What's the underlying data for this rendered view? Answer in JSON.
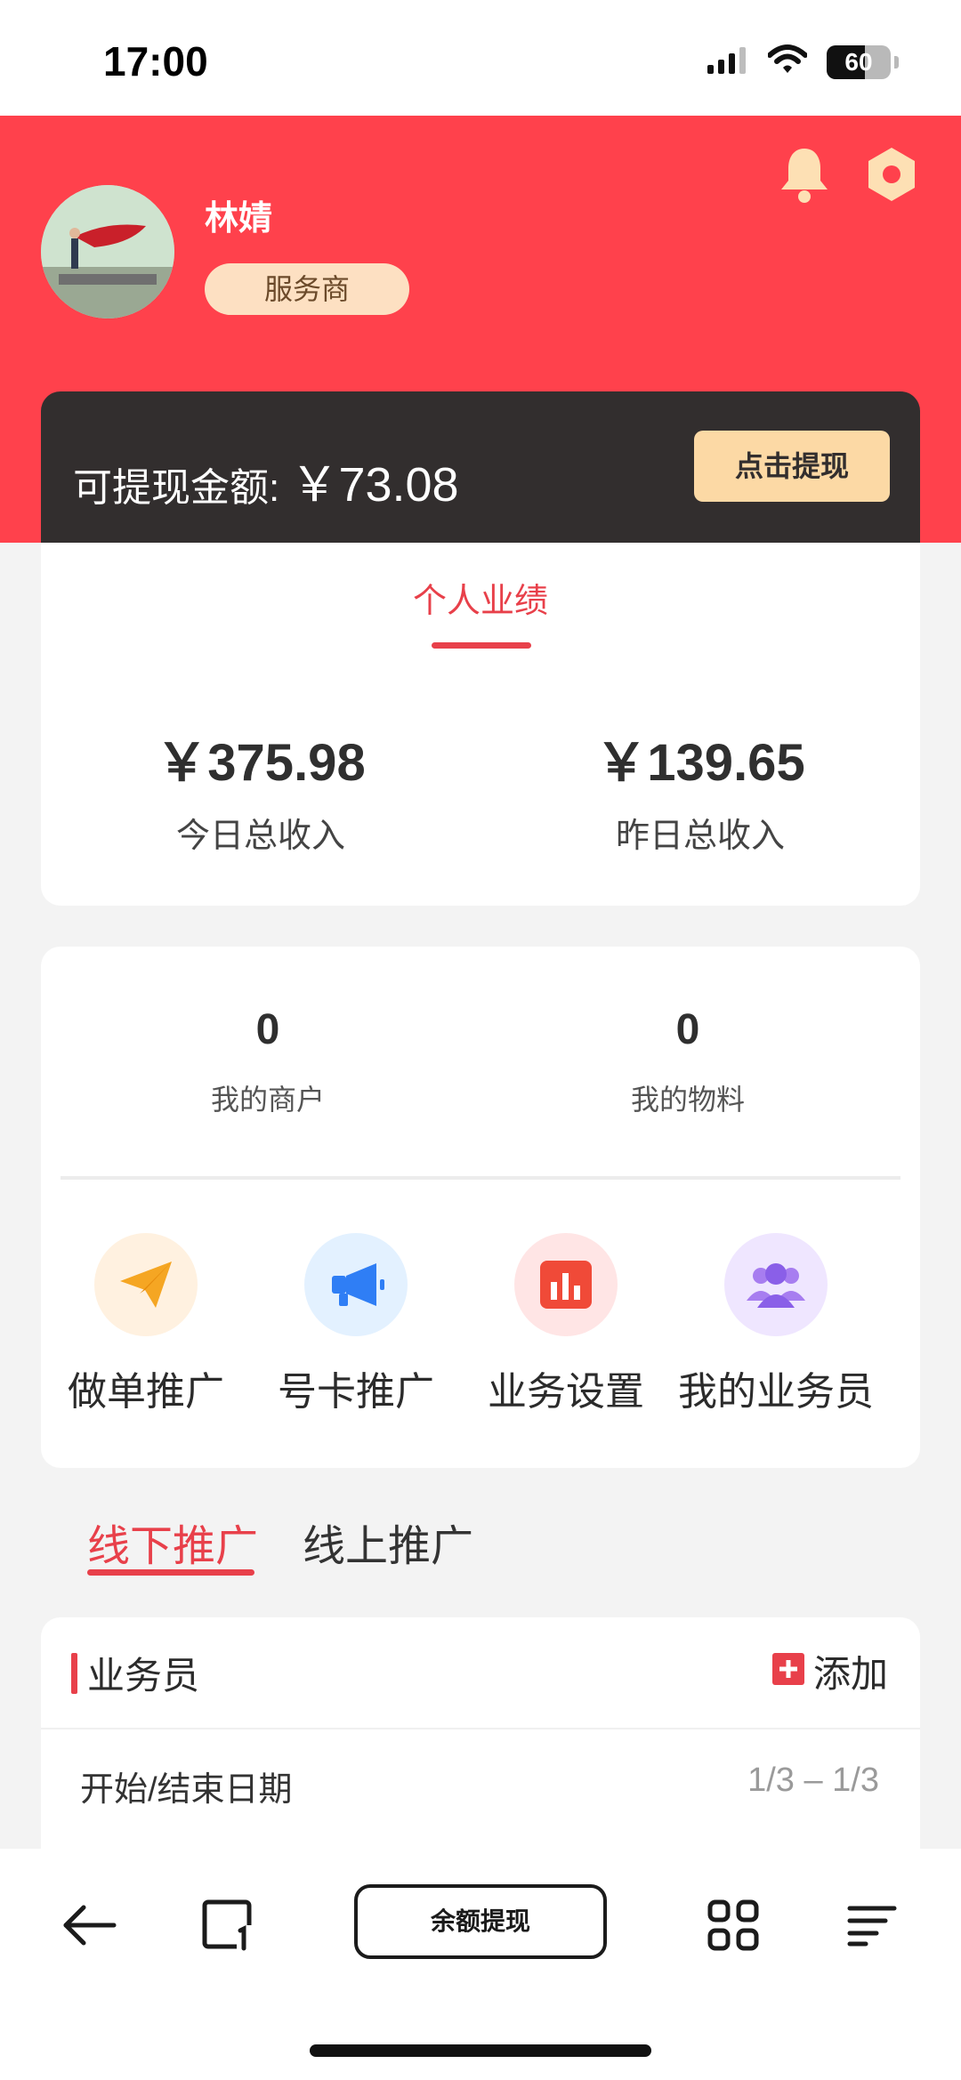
{
  "status_bar": {
    "time": "17:00",
    "battery_percent": "60"
  },
  "header": {
    "user_name": "林婧",
    "role": "服务商",
    "withdraw_label": "可提现金额: ",
    "withdraw_amount": "￥73.08",
    "withdraw_button": "点击提现",
    "colors": {
      "header_bg": "#ff414c",
      "card_dark": "#322e2e",
      "button_gold": "#fcd9a5"
    }
  },
  "performance": {
    "tab": "个人业绩",
    "stats": [
      {
        "value": "￥375.98",
        "label": "今日总收入"
      },
      {
        "value": "￥139.65",
        "label": "昨日总收入"
      }
    ]
  },
  "counts": [
    {
      "value": "0",
      "label": "我的商户"
    },
    {
      "value": "0",
      "label": "我的物料"
    }
  ],
  "actions": [
    {
      "label": "做单推广",
      "icon": "paper-plane-icon"
    },
    {
      "label": "号卡推广",
      "icon": "megaphone-icon"
    },
    {
      "label": "业务设置",
      "icon": "bar-chart-icon"
    },
    {
      "label": "我的业务员",
      "icon": "users-icon"
    }
  ],
  "promo_tabs": [
    {
      "label": "线下推广",
      "active": true
    },
    {
      "label": "线上推广",
      "active": false
    }
  ],
  "staff": {
    "title": "业务员",
    "add_label": "添加",
    "date_label": "开始/结束日期",
    "date_value": "1/3 – 1/3"
  },
  "toolbar": {
    "center_label": "余额提现"
  }
}
